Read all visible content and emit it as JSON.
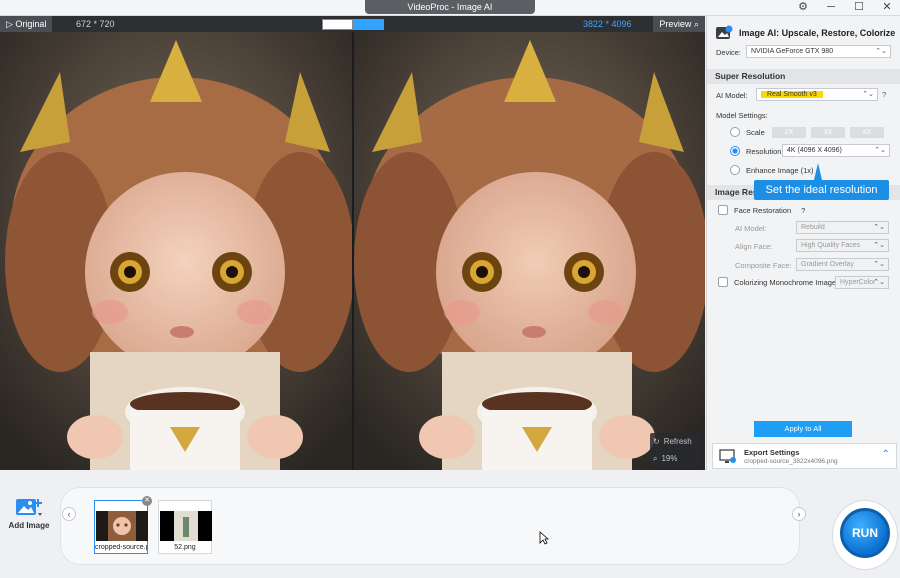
{
  "app": {
    "title": "VideoProc - Image AI"
  },
  "preview": {
    "original_tab": "Original",
    "original_dims": "672 * 720",
    "output_dims": "3822 * 4096",
    "preview_tab": "Preview",
    "tools": {
      "refresh": "Refresh",
      "zoom": "19%"
    }
  },
  "panel": {
    "title": "Image AI: Upscale, Restore, Colorize",
    "device_label": "Device:",
    "device_value": "NVIDIA GeForce GTX 980",
    "super_resolution": {
      "heading": "Super Resolution",
      "ai_model_label": "AI Model:",
      "ai_model_value": "Real Smooth v3",
      "ai_model_help": "?",
      "model_settings_label": "Model Settings:",
      "scale_label": "Scale",
      "scale_options": [
        "2X",
        "3X",
        "4X"
      ],
      "resolution_label": "Resolution",
      "resolution_value": "4K (4096 X 4096)",
      "enhance_label": "Enhance Image (1x)"
    },
    "tooltip": "Set the ideal resolution",
    "image_restoration": {
      "heading": "Image Res",
      "face_restoration_label": "Face Restoration",
      "face_help": "?",
      "ai_model_label": "AI Model:",
      "ai_model_value": "Rebuild",
      "align_face_label": "Align Face:",
      "align_face_value": "High Quality Faces",
      "composite_label": "Composite Face:",
      "composite_value": "Gradient Overlay",
      "colorize_label": "Colorizing Monochrome Image:",
      "colorize_value": "HyperColor"
    },
    "apply_label": "Apply to All",
    "export": {
      "title": "Export Settings",
      "filename": "cropped-source_3822x4096.png"
    }
  },
  "bottom": {
    "add_image_label": "Add Image",
    "thumbnails": [
      {
        "caption": "cropped-source.p"
      },
      {
        "caption": "52.png"
      }
    ],
    "run_label": "RUN"
  },
  "colors": {
    "accent": "#1e9ef5",
    "highlight": "#ffd800"
  }
}
